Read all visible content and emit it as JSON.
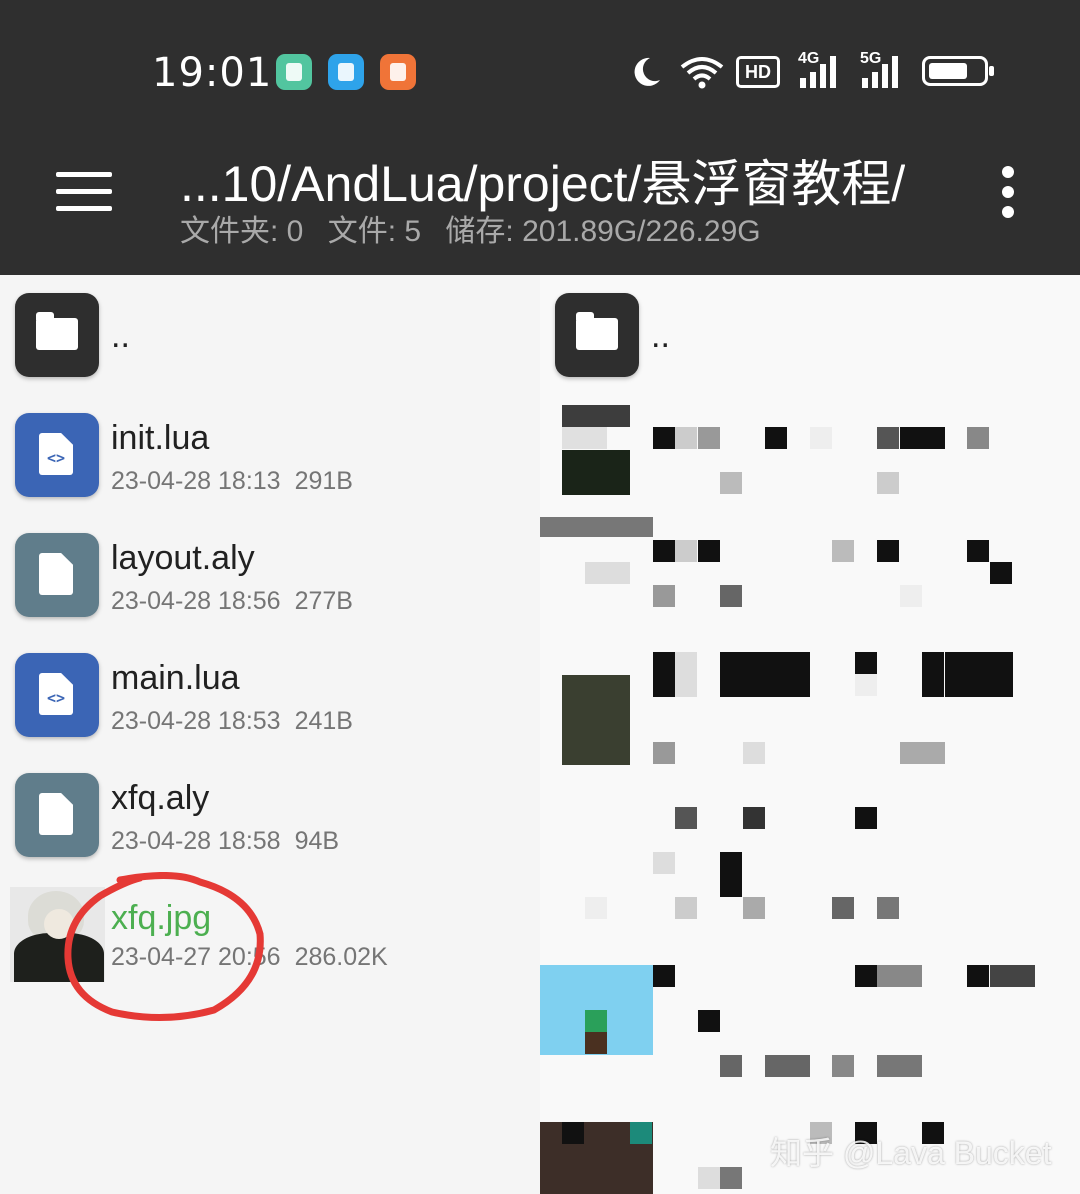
{
  "status_bar": {
    "time": "19:01",
    "app_icons": [
      "green-app-icon",
      "blue-speaker-app-icon",
      "orange-app-icon"
    ],
    "system_icons": [
      "moon-icon",
      "wifi-icon",
      "hd-icon",
      "signal-4g-icon",
      "signal-5g-icon",
      "battery-icon"
    ],
    "hd_label": "HD",
    "signal_4g_label": "4G",
    "signal_5g_label": "5G"
  },
  "toolbar": {
    "path": "...10/AndLua/project/悬浮窗教程/",
    "folders": "文件夹: 0",
    "files": "文件: 5",
    "storage": "储存: 201.89G/226.29G"
  },
  "left_pane": {
    "parent_label": "..",
    "files": [
      {
        "name": "init.lua",
        "date": "23-04-28 18:13",
        "size": "291B",
        "icon": "lua-code-file-icon"
      },
      {
        "name": "layout.aly",
        "date": "23-04-28 18:56",
        "size": "277B",
        "icon": "document-file-icon"
      },
      {
        "name": "main.lua",
        "date": "23-04-28 18:53",
        "size": "241B",
        "icon": "lua-code-file-icon"
      },
      {
        "name": "xfq.aly",
        "date": "23-04-28 18:58",
        "size": "94B",
        "icon": "document-file-icon"
      },
      {
        "name": "xfq.jpg",
        "date": "23-04-27 20:56",
        "size": "286.02K",
        "icon": "image-thumbnail"
      }
    ]
  },
  "right_pane": {
    "parent_label": ".."
  },
  "watermark": "知乎 @Lava Bucket",
  "colors": {
    "bar_bg": "#2f2f2f",
    "code_icon": "#3b65b5",
    "doc_icon": "#607d8b",
    "highlight_name": "#4caf50",
    "annotation_red": "#e53935"
  }
}
